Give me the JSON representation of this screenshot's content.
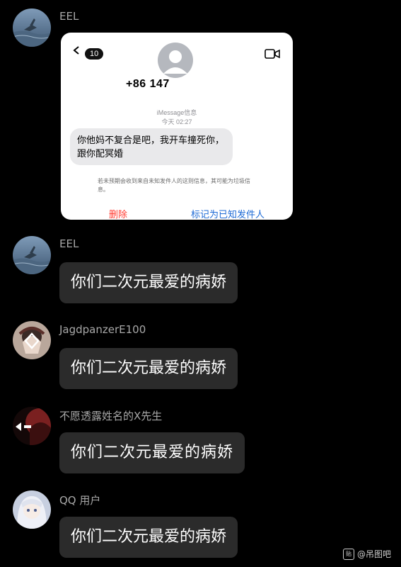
{
  "messages": [
    {
      "name": "EEL",
      "avatar_icon": "sea-bird-avatar",
      "type": "image",
      "card": {
        "badge": "10",
        "phone": "+86 147",
        "service": "iMessage信息",
        "time": "今天 02:27",
        "sms_text": "你他妈不复合是吧，我开车撞死你，跟你配冥婚",
        "warning": "若未预期会收到来自未知发件人的这则信息，其可能为垃圾信息。",
        "delete_label": "删除",
        "mark_label": "标记为已知发件人"
      }
    },
    {
      "name": "EEL",
      "avatar_icon": "sea-bird-avatar",
      "type": "text",
      "text": "你们二次元最爱的病娇"
    },
    {
      "name": "JagdpanzerE100",
      "avatar_icon": "anime-character-avatar",
      "type": "text",
      "text": "你们二次元最爱的病娇"
    },
    {
      "name": "不愿透露姓名的X先生",
      "avatar_icon": "dark-anime-avatar",
      "type": "text",
      "text": "你们二次元最爱的病娇"
    },
    {
      "name": "QQ 用户",
      "avatar_icon": "white-hair-anime-avatar",
      "type": "text",
      "text": "你们二次元最爱的病娇"
    }
  ],
  "watermark": {
    "icon": "tieba-icon",
    "icon_text": "贴",
    "text": "@吊图吧"
  },
  "colors": {
    "background": "#000000",
    "bubble": "#2b2b2b",
    "name": "#a8a8a8",
    "delete_red": "#ff3b30",
    "link_blue": "#1e6bd6"
  }
}
